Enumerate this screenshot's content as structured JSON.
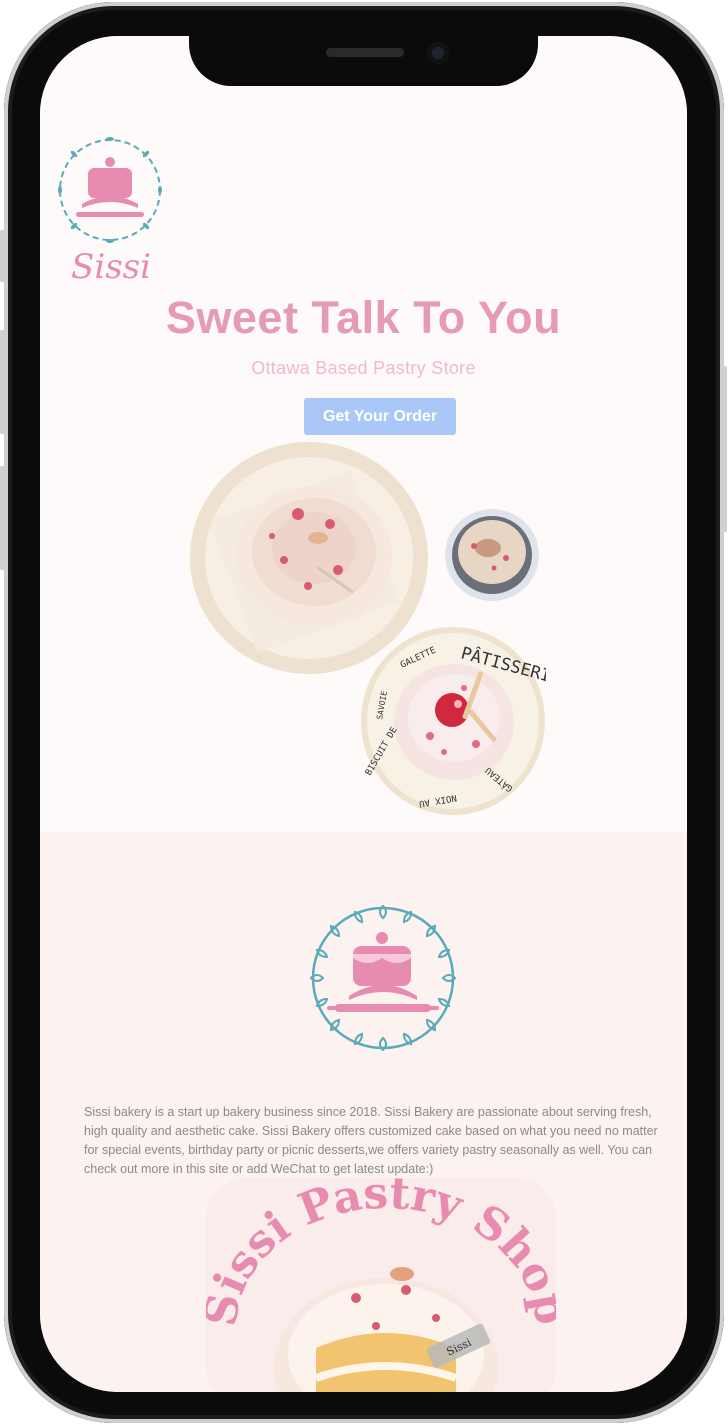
{
  "brand": {
    "logo_text": "Sissi"
  },
  "hero": {
    "title": "Sweet Talk To You",
    "subtitle": "Ottawa Based Pastry Store",
    "cta_label": "Get Your Order",
    "plate_text": [
      "PÂTISSERIE",
      "GALETTE",
      "SAVOIE",
      "BISCUIT DE",
      "NOIX AU",
      "GÂTEAU"
    ]
  },
  "about": {
    "text": "Sissi bakery is a start up bakery business since 2018. Sissi Bakery are passionate about serving fresh, high quality and aesthetic cake. Sissi Bakery offers customized cake based on what you need no matter for special events, birthday party or picnic desserts,we offers variety pastry seasonally as well. You can check out more in this site or add WeChat to get latest update:)",
    "badge_text": "Sissi Pastry Shop",
    "cake_tag": "Sissi"
  },
  "colors": {
    "accent_pink": "#e59ab6",
    "subtitle_pink": "#f1b9cb",
    "cta_blue": "#a9c8f8",
    "wreath_teal": "#5aaab8",
    "hero_bg": "#fdfaf9",
    "about_bg": "#fcf2f0"
  },
  "icons": [
    "sissi-logo-icon",
    "cake-icon",
    "rolling-pin-icon",
    "wreath-icon"
  ]
}
